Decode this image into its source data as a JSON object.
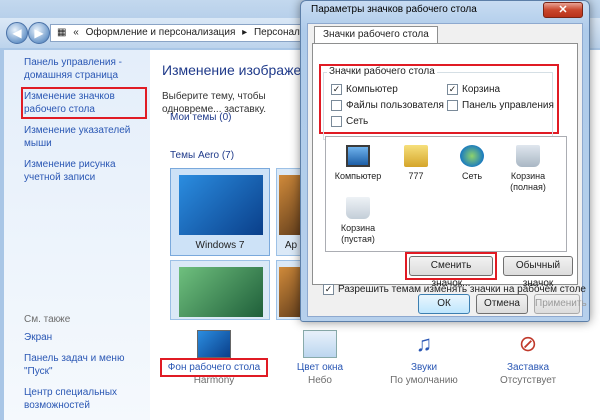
{
  "control_panel": {
    "breadcrumb": [
      "«",
      "Оформление и персонализация",
      "Персонализация"
    ],
    "sidebar": {
      "links": [
        "Панель управления - домашняя страница",
        "Изменение значков рабочего стола",
        "Изменение указателей мыши",
        "Изменение рисунка учетной записи"
      ],
      "see_also_header": "См. также",
      "see_also": [
        "Экран",
        "Панель задач и меню \"Пуск\"",
        "Центр специальных возможностей"
      ]
    },
    "main": {
      "title": "Изменение изображения и",
      "description": "Выберите тему, чтобы одновреме... заставку.",
      "my_themes": "Мои темы (0)",
      "aero_themes": "Темы Aero (7)",
      "themes": [
        "Windows 7",
        "Ар"
      ]
    },
    "bottom": [
      {
        "title": "Фон рабочего стола",
        "sub": "Harmony"
      },
      {
        "title": "Цвет окна",
        "sub": "Небо"
      },
      {
        "title": "Звуки",
        "sub": "По умолчанию"
      },
      {
        "title": "Заставка",
        "sub": "Отсутствует"
      }
    ]
  },
  "dialog": {
    "title": "Параметры значков рабочего стола",
    "tab": "Значки рабочего стола",
    "group_title": "Значки рабочего стола",
    "checkboxes": [
      {
        "label": "Компьютер",
        "checked": true
      },
      {
        "label": "Корзина",
        "checked": true
      },
      {
        "label": "Файлы пользователя",
        "checked": false
      },
      {
        "label": "Панель управления",
        "checked": false
      },
      {
        "label": "Сеть",
        "checked": false
      }
    ],
    "icons": [
      "Компьютер",
      "777",
      "Сеть",
      "Корзина (полная)",
      "Корзина (пустая)"
    ],
    "change_icon": "Сменить значок...",
    "default_icon": "Обычный значок",
    "allow_themes": "Разрешить темам изменять значки на рабочем столе",
    "ok": "ОК",
    "cancel": "Отмена",
    "apply": "Применить"
  }
}
